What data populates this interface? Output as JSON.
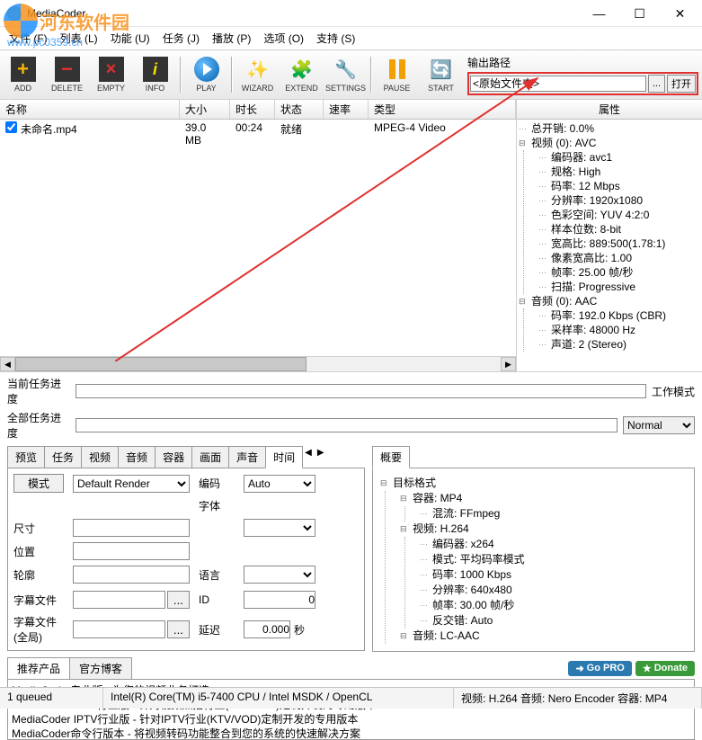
{
  "window": {
    "title": "MediaCoder"
  },
  "watermark": {
    "text": "河东软件园",
    "url": "www.pc0359.cn"
  },
  "menu": {
    "file": "文件 (F)",
    "list": "列表 (L)",
    "function": "功能 (U)",
    "job": "任务 (J)",
    "play": "播放 (P)",
    "options": "选项 (O)",
    "support": "支持 (S)"
  },
  "toolbar": {
    "add": "ADD",
    "delete": "DELETE",
    "empty": "EMPTY",
    "info": "INFO",
    "play": "PLAY",
    "wizard": "WIZARD",
    "extend": "EXTEND",
    "settings": "SETTINGS",
    "pause": "PAUSE",
    "start": "START"
  },
  "output": {
    "label": "输出路径",
    "value": "<原始文件夹>",
    "browse": "...",
    "open": "打开"
  },
  "filelist": {
    "columns": {
      "name": "名称",
      "size": "大小",
      "duration": "时长",
      "status": "状态",
      "rate": "速率",
      "type": "类型"
    },
    "rows": [
      {
        "checked": true,
        "name": "未命名.mp4",
        "size": "39.0 MB",
        "duration": "00:24",
        "status": "就绪",
        "rate": "",
        "type": "MPEG-4 Video"
      }
    ]
  },
  "properties": {
    "header": "属性",
    "overhead": "总开销: 0.0%",
    "video_label": "视频 (0): AVC",
    "video": {
      "encoder": "编码器: avc1",
      "profile": "规格: High",
      "bitrate": "码率: 12 Mbps",
      "resolution": "分辨率: 1920x1080",
      "colorspace": "色彩空间: YUV 4:2:0",
      "bitdepth": "样本位数: 8-bit",
      "aspect": "宽高比: 889:500(1.78:1)",
      "par": "像素宽高比: 1.00",
      "fps": "帧率: 25.00 帧/秒",
      "scan": "扫描: Progressive"
    },
    "audio_label": "音频 (0): AAC",
    "audio": {
      "bitrate": "码率: 192.0 Kbps (CBR)",
      "samplerate": "采样率: 48000 Hz",
      "channels": "声道: 2 (Stereo)"
    }
  },
  "progress": {
    "current": "当前任务进度",
    "total": "全部任务进度"
  },
  "workmode": {
    "label": "工作模式",
    "value": "Normal"
  },
  "left_tabs": {
    "items": [
      "预览",
      "任务",
      "视频",
      "音频",
      "容器",
      "画面",
      "声音",
      "时间"
    ],
    "active": "时间",
    "form": {
      "mode_btn": "模式",
      "mode_value": "Default Render",
      "encode_label": "编码",
      "encode_value": "Auto",
      "size_label": "尺寸",
      "font_label": "字体",
      "position_label": "位置",
      "outline_label": "轮廓",
      "lang_label": "语言",
      "subfile_label": "字幕文件",
      "browse": "...",
      "id_label": "ID",
      "id_value": "0",
      "subglobal_label": "字幕文件 (全局)",
      "delay_label": "延迟",
      "delay_value": "0.000",
      "delay_unit": "秒"
    }
  },
  "right_tabs": {
    "items": [
      "概要"
    ],
    "active": "概要",
    "summary": {
      "target": "目标格式",
      "container": "容器: MP4",
      "mux": "混流: FFmpeg",
      "video_label": "视频: H.264",
      "v_encoder": "编码器: x264",
      "v_mode": "模式: 平均码率模式",
      "v_bitrate": "码率: 1000 Kbps",
      "v_res": "分辨率: 640x480",
      "v_fps": "帧率: 30.00 帧/秒",
      "v_deint": "反交错: Auto",
      "audio_label": "音频: LC-AAC"
    }
  },
  "promo": {
    "tabs": [
      "推荐产品",
      "官方博客"
    ],
    "gopro": "Go PRO",
    "donate": "Donate",
    "lines": [
      "MediaCoder专业版 - 为您的视频业务打造",
      "MediaCoder VOD行业版 - 针对视频点播行业(KTV/VOD)定制开发的专用版本",
      "MediaCoder IPTV行业版 - 针对IPTV行业(KTV/VOD)定制开发的专用版本",
      "MediaCoder命令行版本 - 将视频转码功能整合到您的系统的快速解决方案"
    ]
  },
  "statusbar": {
    "queued": "1 queued",
    "cpu": "Intel(R) Core(TM) i5-7400 CPU  / Intel MSDK / OpenCL",
    "codec": "视频: H.264  音频: Nero Encoder   容器: MP4"
  }
}
